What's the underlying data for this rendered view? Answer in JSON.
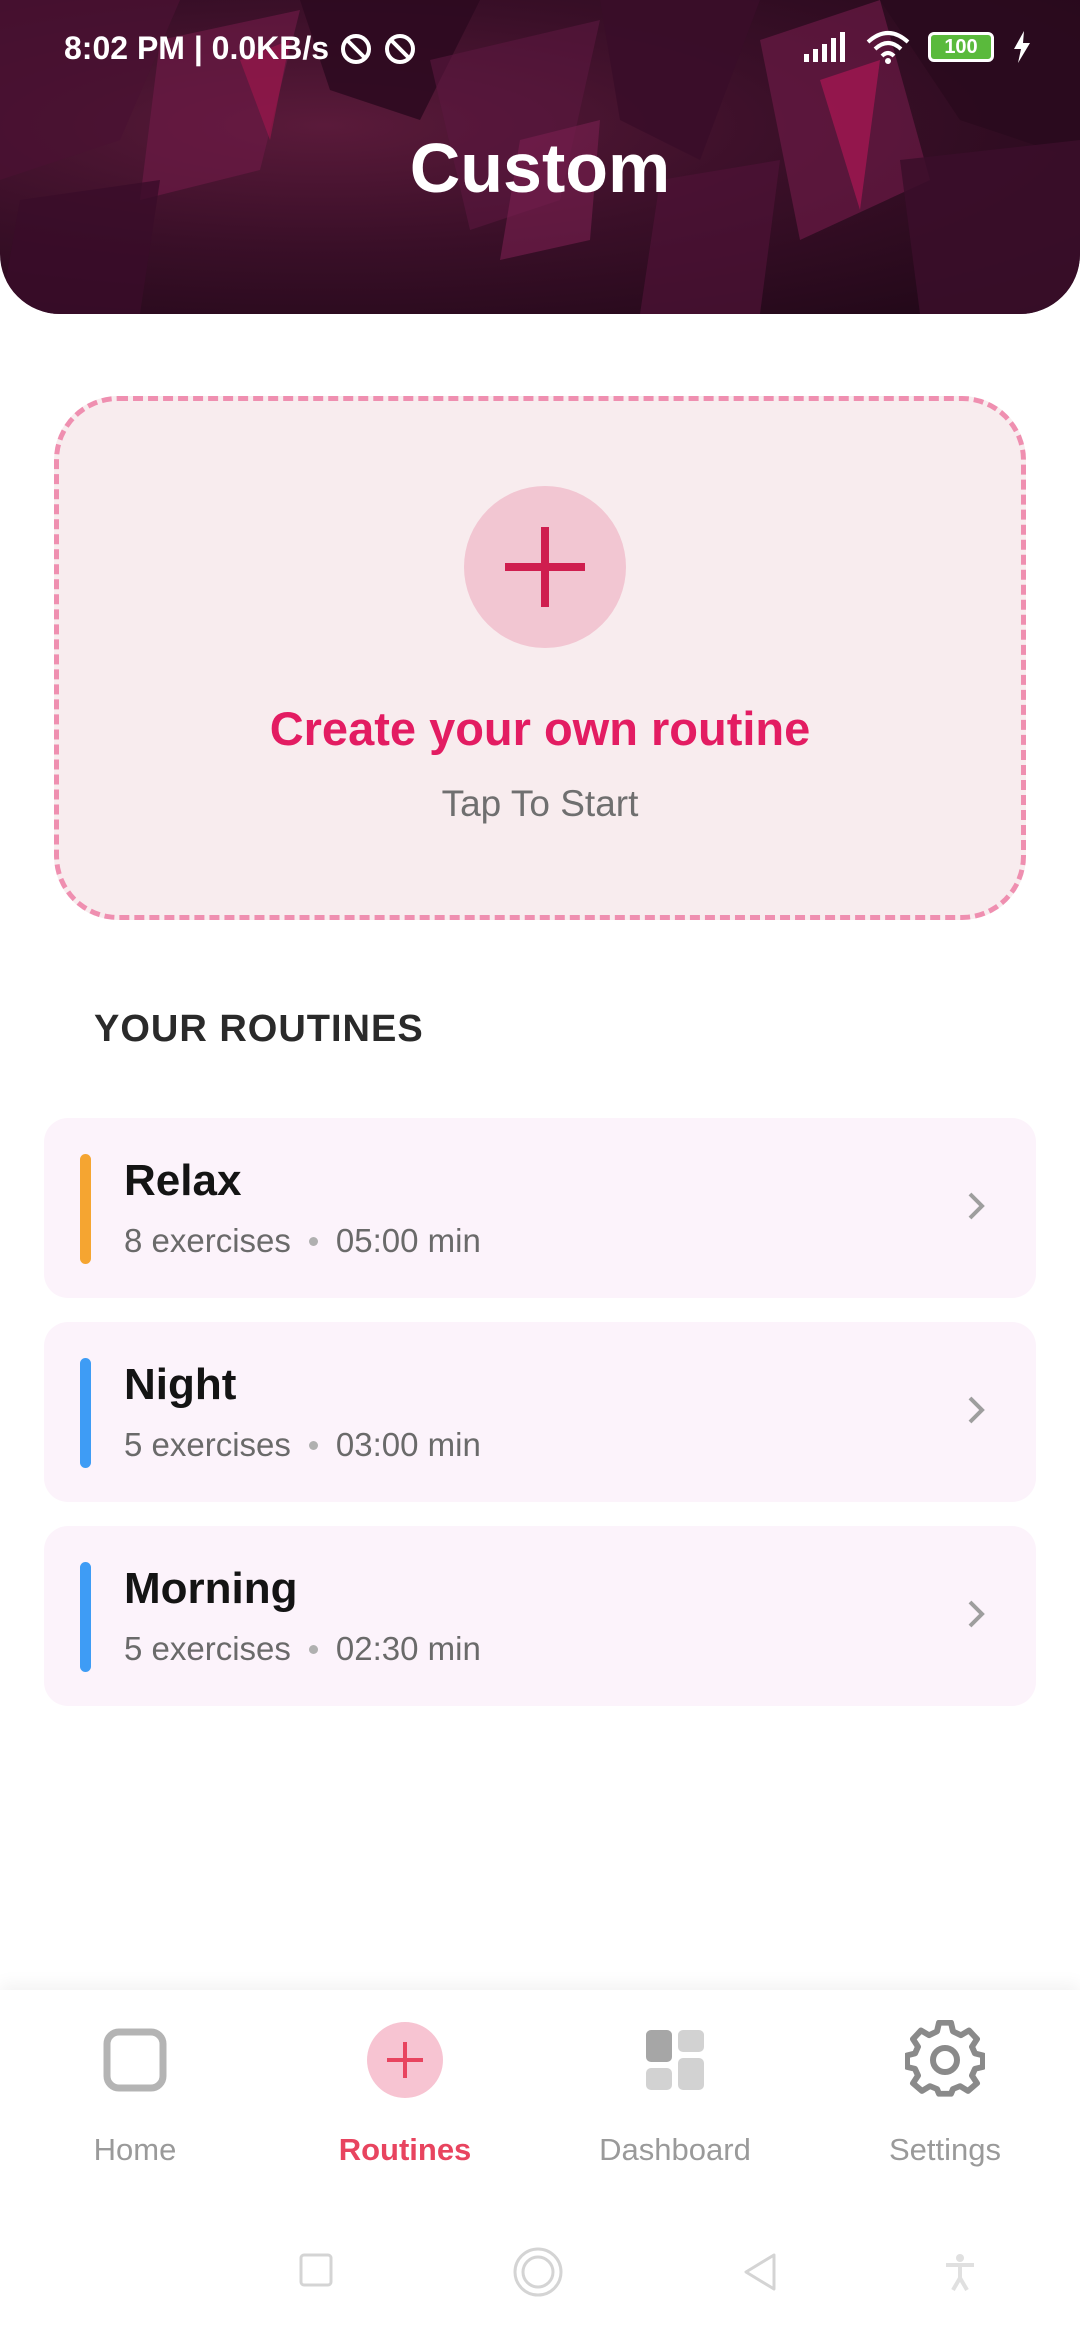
{
  "status_bar": {
    "time_speed": "8:02 PM | 0.0KB/s",
    "battery": "100"
  },
  "header": {
    "title": "Custom"
  },
  "create_card": {
    "title": "Create your own routine",
    "subtitle": "Tap To Start",
    "icon": "plus-icon"
  },
  "section": {
    "title": "YOUR ROUTINES"
  },
  "routines": [
    {
      "name": "Relax",
      "exercises": "8 exercises",
      "duration": "05:00 min",
      "accent": "#f5a531"
    },
    {
      "name": "Night",
      "exercises": "5 exercises",
      "duration": "03:00 min",
      "accent": "#3e9cf5"
    },
    {
      "name": "Morning",
      "exercises": "5 exercises",
      "duration": "02:30 min",
      "accent": "#3e9cf5"
    }
  ],
  "bottom_nav": {
    "items": [
      {
        "label": "Home",
        "icon": "home-square-icon"
      },
      {
        "label": "Routines",
        "icon": "plus-circle-icon"
      },
      {
        "label": "Dashboard",
        "icon": "dashboard-icon"
      },
      {
        "label": "Settings",
        "icon": "gear-icon"
      }
    ],
    "active": "Routines"
  },
  "colors": {
    "brand_pink": "#e31c62",
    "nav_active": "#e8445f",
    "card_bg": "#f8ecee",
    "routine_bg": "#fcf3fb"
  }
}
